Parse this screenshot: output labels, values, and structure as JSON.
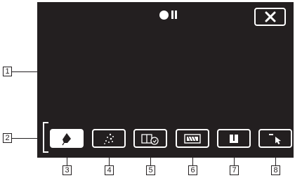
{
  "screen": {
    "background": "#231f20",
    "recording_status_icon": "record-pause-indicator-icon",
    "close_icon": "close-icon"
  },
  "toolbar": {
    "buttons": [
      {
        "icon": "pen-icon",
        "selected": true
      },
      {
        "icon": "sparkle-stamp-icon",
        "selected": false
      },
      {
        "icon": "book-timer-icon",
        "selected": false
      },
      {
        "icon": "eraser-icon",
        "selected": false
      },
      {
        "icon": "pause-icon",
        "selected": false
      },
      {
        "icon": "minimize-arrow-icon",
        "selected": false
      }
    ]
  },
  "callouts": {
    "c1": "1",
    "c2": "2",
    "c3": "3",
    "c4": "4",
    "c5": "5",
    "c6": "6",
    "c7": "7",
    "c8": "8"
  },
  "colors": {
    "screen": "#231f20",
    "foreground": "#ffffff"
  }
}
